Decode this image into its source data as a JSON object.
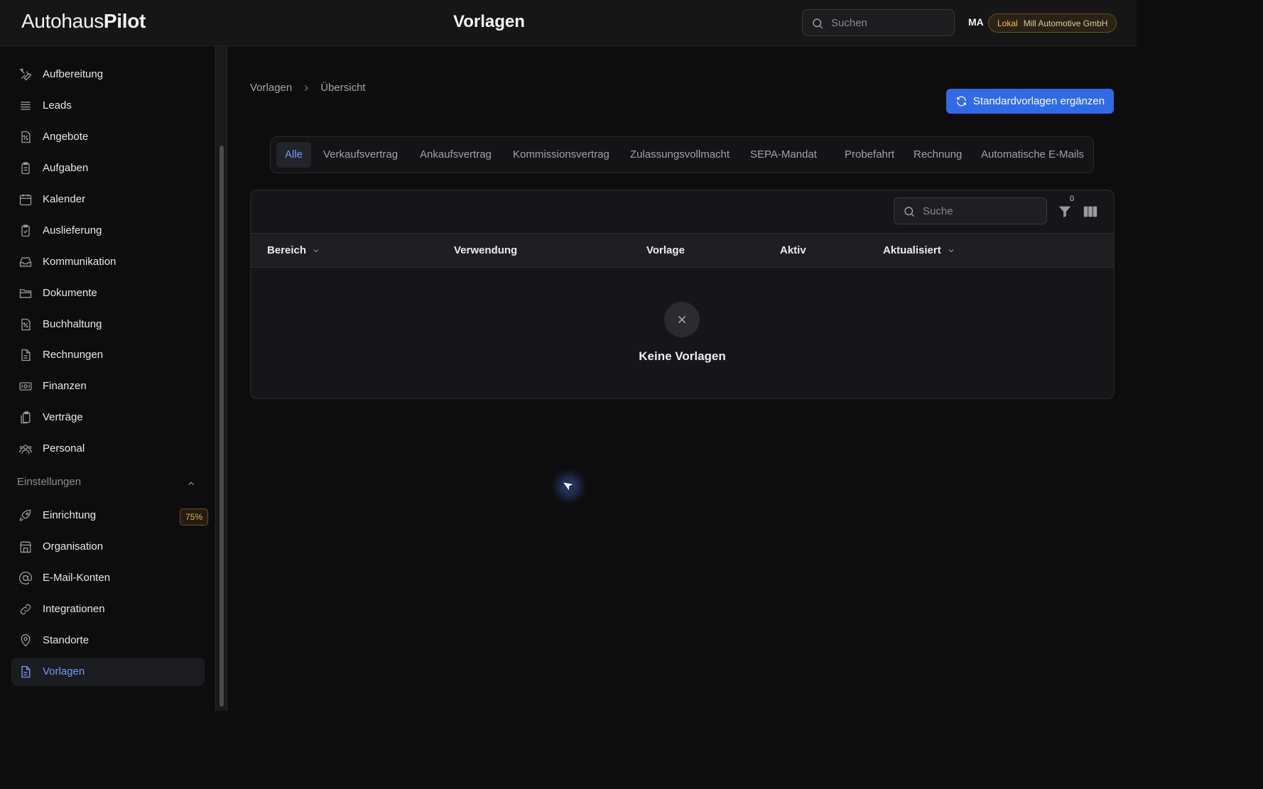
{
  "app": {
    "logo_light": "Autohaus",
    "logo_bold": "Pilot",
    "page_title": "Vorlagen",
    "search_placeholder": "Suchen",
    "user_initials": "MA",
    "environment": "Lokal",
    "organization": "Mill Automotive GmbH"
  },
  "sidebar": {
    "items": [
      {
        "label": "Aufbereitung",
        "icon": "tools-icon"
      },
      {
        "label": "Leads",
        "icon": "list-icon"
      },
      {
        "label": "Angebote",
        "icon": "percent-doc-icon"
      },
      {
        "label": "Aufgaben",
        "icon": "clipboard-icon"
      },
      {
        "label": "Kalender",
        "icon": "calendar-icon"
      },
      {
        "label": "Auslieferung",
        "icon": "clipboard-check-icon"
      },
      {
        "label": "Kommunikation",
        "icon": "inbox-icon"
      },
      {
        "label": "Dokumente",
        "icon": "folder-icon"
      },
      {
        "label": "Buchhaltung",
        "icon": "percent-doc-icon"
      },
      {
        "label": "Rechnungen",
        "icon": "document-icon"
      },
      {
        "label": "Finanzen",
        "icon": "cash-icon"
      },
      {
        "label": "Verträge",
        "icon": "clipboard-copy-icon"
      },
      {
        "label": "Personal",
        "icon": "users-icon"
      }
    ],
    "settings_section": {
      "label": "Einstellungen",
      "items": [
        {
          "label": "Einrichtung",
          "icon": "rocket-icon",
          "badge": "75%"
        },
        {
          "label": "Organisation",
          "icon": "building-icon"
        },
        {
          "label": "E-Mail-Konten",
          "icon": "at-icon"
        },
        {
          "label": "Integrationen",
          "icon": "link-icon"
        },
        {
          "label": "Standorte",
          "icon": "map-pin-icon"
        },
        {
          "label": "Vorlagen",
          "icon": "file-text-icon",
          "active": true
        }
      ]
    }
  },
  "breadcrumb": [
    "Vorlagen",
    "Übersicht"
  ],
  "actions": {
    "add_defaults": "Standardvorlagen ergänzen"
  },
  "tabs": [
    "Alle",
    "Verkaufsvertrag",
    "Ankaufsvertrag",
    "Kommissionsvertrag",
    "Zulassungsvollmacht",
    "SEPA-Mandat",
    "Probefahrt",
    "Rechnung",
    "Automatische E-Mails"
  ],
  "active_tab": "Alle",
  "table": {
    "search_placeholder": "Suche",
    "filter_count": "0",
    "columns": [
      "Bereich",
      "Verwendung",
      "Vorlage",
      "Aktiv",
      "Aktualisiert"
    ],
    "rows": [],
    "empty_text": "Keine Vorlagen"
  },
  "colors": {
    "accent": "#2f6be6",
    "active_text": "#6f9cf7",
    "badge": "#e2b346"
  }
}
